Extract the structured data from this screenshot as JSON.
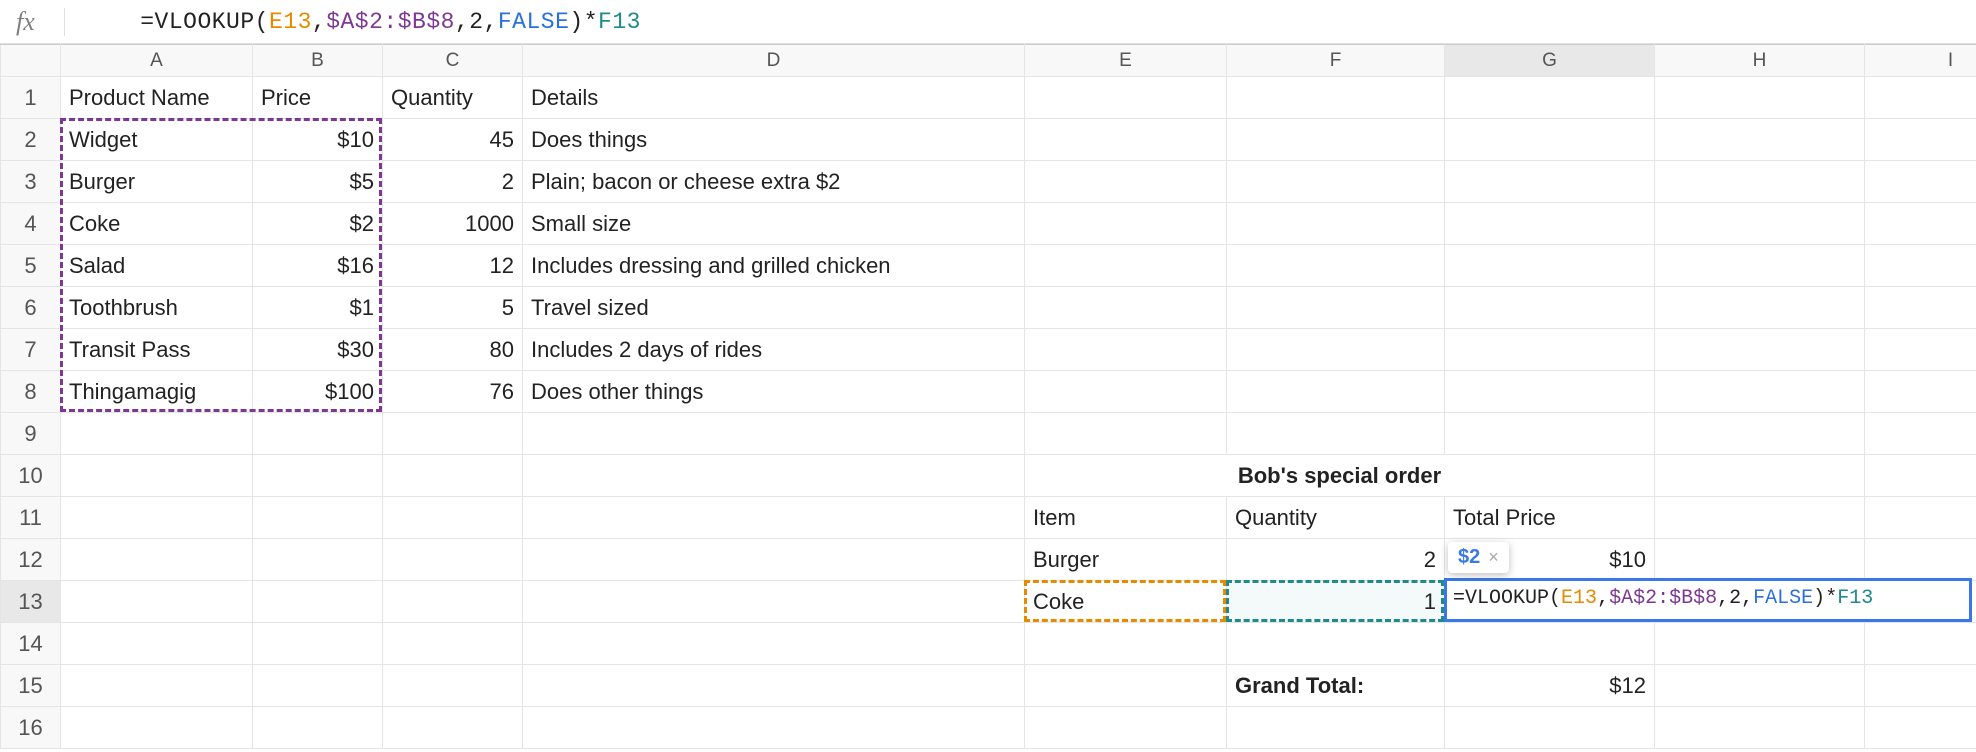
{
  "formula_bar": {
    "fx": "fx",
    "eq": "=",
    "fn": "VLOOKUP",
    "lp": "(",
    "arg1": "E13",
    "c1": ",",
    "arg2": "$A$2:$B$8",
    "c2": ",",
    "arg3": "2",
    "c3": ",",
    "arg4": "FALSE",
    "rp": ")",
    "mul": "*",
    "arg5": "F13"
  },
  "columns": [
    "A",
    "B",
    "C",
    "D",
    "E",
    "F",
    "G",
    "H",
    "I"
  ],
  "row_numbers": [
    "1",
    "2",
    "3",
    "4",
    "5",
    "6",
    "7",
    "8",
    "9",
    "10",
    "11",
    "12",
    "13",
    "14",
    "15",
    "16"
  ],
  "headers": {
    "a": "Product Name",
    "b": "Price",
    "c": "Quantity",
    "d": "Details"
  },
  "products": [
    {
      "name": "Widget",
      "price": "$10",
      "qty": "45",
      "details": "Does things"
    },
    {
      "name": "Burger",
      "price": "$5",
      "qty": "2",
      "details": "Plain; bacon or cheese extra $2"
    },
    {
      "name": "Coke",
      "price": "$2",
      "qty": "1000",
      "details": "Small size"
    },
    {
      "name": "Salad",
      "price": "$16",
      "qty": "12",
      "details": "Includes dressing and grilled chicken"
    },
    {
      "name": "Toothbrush",
      "price": "$1",
      "qty": "5",
      "details": "Travel sized"
    },
    {
      "name": "Transit Pass",
      "price": "$30",
      "qty": "80",
      "details": "Includes 2 days of rides"
    },
    {
      "name": "Thingamagig",
      "price": "$100",
      "qty": "76",
      "details": "Does other things"
    }
  ],
  "order": {
    "title": "Bob's special order",
    "item_h": "Item",
    "qty_h": "Quantity",
    "total_h": "Total Price",
    "rows": [
      {
        "item": "Burger",
        "qty": "2",
        "total": "$10"
      },
      {
        "item": "Coke",
        "qty": "1",
        "total": ""
      }
    ],
    "grand_label": "Grand Total:",
    "grand_value": "$12"
  },
  "active_formula": {
    "eq": "=",
    "fn": "VLOOKUP",
    "lp": "(",
    "a1": "E13",
    "c1": ",",
    "a2": "$A$2:$B$8",
    "c2": ",",
    "a3": "2",
    "c3": ",",
    "a4": "FALSE",
    "rp": ")",
    "mul": "*",
    "a5": "F13"
  },
  "preview": {
    "value": "$2",
    "close": "×"
  }
}
